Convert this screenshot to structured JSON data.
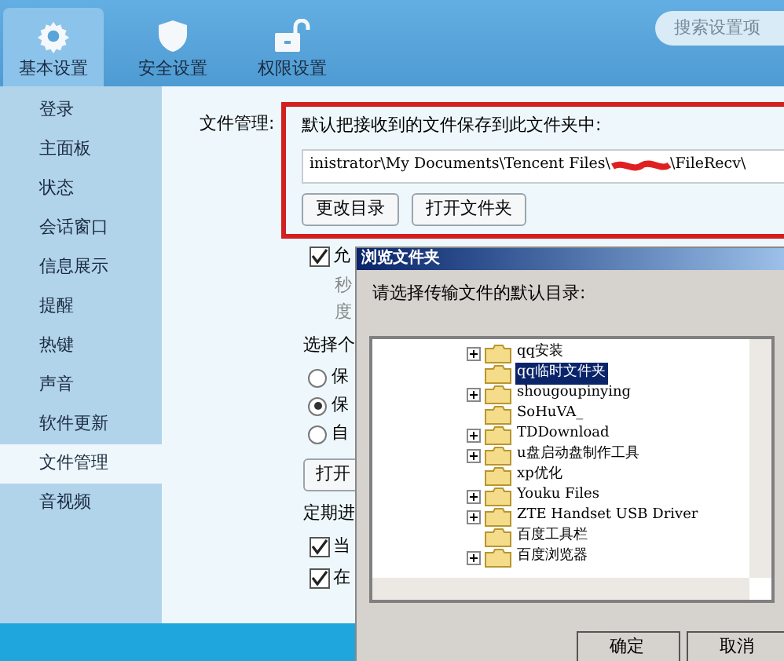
{
  "toolbar": {
    "tabs": [
      {
        "label": "基本设置",
        "kind": "gear",
        "selected": true
      },
      {
        "label": "安全设置",
        "kind": "shield",
        "selected": false
      },
      {
        "label": "权限设置",
        "kind": "lock",
        "selected": false
      }
    ],
    "search": {
      "placeholder": "搜索设置项"
    }
  },
  "sidebar": {
    "items": [
      {
        "label": "登录",
        "selected": false
      },
      {
        "label": "主面板",
        "selected": false
      },
      {
        "label": "状态",
        "selected": false
      },
      {
        "label": "会话窗口",
        "selected": false
      },
      {
        "label": "信息展示",
        "selected": false
      },
      {
        "label": "提醒",
        "selected": false
      },
      {
        "label": "热键",
        "selected": false
      },
      {
        "label": "声音",
        "selected": false
      },
      {
        "label": "软件更新",
        "selected": false
      },
      {
        "label": "文件管理",
        "selected": true
      },
      {
        "label": "音视频",
        "selected": false
      }
    ]
  },
  "file_management": {
    "label": "文件管理:",
    "prompt": "默认把接收到的文件保存到此文件夹中:",
    "path_before": "inistrator\\My Documents\\Tencent Files\\",
    "path_after": "\\FileRecv\\",
    "buttons": [
      "更改目录",
      "打开文件夹"
    ]
  },
  "options": [
    {
      "kind": "checkbox",
      "label": "允",
      "checked": true
    },
    {
      "kind": "note",
      "label": "秒"
    },
    {
      "kind": "note",
      "label": "度"
    },
    {
      "kind": "heading",
      "label": "选择个"
    },
    {
      "kind": "radio",
      "label": "保",
      "selected": false
    },
    {
      "kind": "radio",
      "label": "保",
      "selected": true
    },
    {
      "kind": "radio",
      "label": "自",
      "selected": false
    },
    {
      "kind": "button",
      "label": "打开"
    },
    {
      "kind": "heading",
      "label": "定期进"
    },
    {
      "kind": "checkbox",
      "label": "当",
      "checked": true
    },
    {
      "kind": "checkbox",
      "label": "在",
      "checked": true
    }
  ],
  "dialog": {
    "title": "浏览文件夹",
    "prompt": "请选择传输文件的默认目录:",
    "tree": [
      {
        "label": "qq安装",
        "expandable": true,
        "selected": false
      },
      {
        "label": "qq临时文件夹",
        "expandable": false,
        "selected": true
      },
      {
        "label": "shougoupinying",
        "expandable": true,
        "selected": false
      },
      {
        "label": "SoHuVA_",
        "expandable": false,
        "selected": false
      },
      {
        "label": "TDDownload",
        "expandable": true,
        "selected": false
      },
      {
        "label": "u盘启动盘制作工具",
        "expandable": true,
        "selected": false
      },
      {
        "label": "xp优化",
        "expandable": false,
        "selected": false
      },
      {
        "label": "Youku Files",
        "expandable": true,
        "selected": false
      },
      {
        "label": "ZTE Handset USB Driver",
        "expandable": true,
        "selected": false
      },
      {
        "label": "百度工具栏",
        "expandable": false,
        "selected": false
      },
      {
        "label": "百度浏览器",
        "expandable": true,
        "selected": false
      }
    ],
    "buttons": [
      "确定",
      "取消"
    ]
  }
}
